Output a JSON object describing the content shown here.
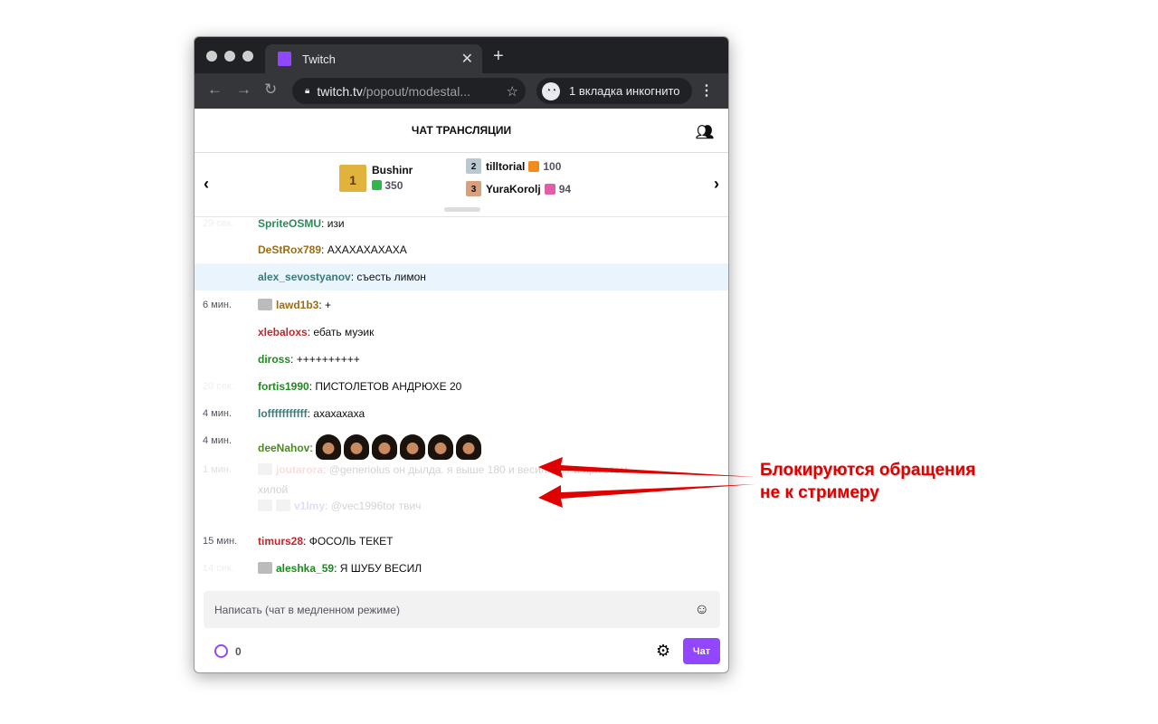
{
  "browser": {
    "tab_title": "Twitch",
    "url_host": "twitch.tv",
    "url_path": "/popout/modestal...",
    "incognito_label": "1 вкладка инкогнито"
  },
  "chat_header": {
    "title": "ЧАТ ТРАНСЛЯЦИИ"
  },
  "leaderboard": [
    {
      "rank": "1",
      "name": "Bushinr",
      "count": "350",
      "gift_color": "#2db84a"
    },
    {
      "rank": "2",
      "name": "tilltorial",
      "count": "100",
      "gift_color": "#f08c1e"
    },
    {
      "rank": "3",
      "name": "YuraKorolj",
      "count": "94",
      "gift_color": "#e05fa8"
    }
  ],
  "messages": [
    {
      "time": "29 сек.",
      "user": "SpriteOSMU",
      "color": "#2e8b57",
      "text": "изи"
    },
    {
      "time": "",
      "user": "DeStRox789",
      "color": "#9a6d16",
      "text": "АХАХАХАХАХА"
    },
    {
      "time": "",
      "user": "alex_sevostyanov",
      "color": "#3a7a7a",
      "text": "съесть лимон"
    },
    {
      "time": "6 мин.",
      "user": "lawd1b3",
      "color": "#9a6d16",
      "text": "+"
    },
    {
      "time": "",
      "user": "xlebaloxs",
      "color": "#c0282d",
      "text": "ебать муэик"
    },
    {
      "time": "",
      "user": "diross",
      "color": "#1e8a1e",
      "text": "++++++++++"
    },
    {
      "time": "20 сек.",
      "user": "fortis1990",
      "color": "#1e8a1e",
      "text": "ПИСТОЛЕТОВ АНДРЮХЕ 20"
    },
    {
      "time": "4 мин.",
      "user": "lofffffffffff",
      "color": "#3a7a7a",
      "text": "ахахахаха"
    },
    {
      "time": "4 мин.",
      "user": "deeNahov",
      "color": "#4b8a1e",
      "text": ""
    },
    {
      "time": "1 мин.",
      "user": "joutarora",
      "color": "#e05050",
      "text": "@generiolus он дылда. я выше 180 и весил 80кг и при этом",
      "text2": "хилой"
    },
    {
      "time": "",
      "user": "v1lmy",
      "color": "#5050e0",
      "text": "@vec1996tor твич"
    },
    {
      "time": "15 мин.",
      "user": "timurs28",
      "color": "#c0282d",
      "text": "ФОСОЛЬ ТЕКЕТ"
    },
    {
      "time": "14 сек.",
      "user": "aleshka_59",
      "color": "#1e8a1e",
      "text": "Я ШУБУ ВЕСИЛ"
    }
  ],
  "input": {
    "placeholder": "Написать (чат в медленном режиме)"
  },
  "footer": {
    "points": "0",
    "send_label": "Чат"
  },
  "annotation": {
    "line1": "Блокируются обращения",
    "line2": "не к стримеру",
    "color": "#e00000"
  }
}
